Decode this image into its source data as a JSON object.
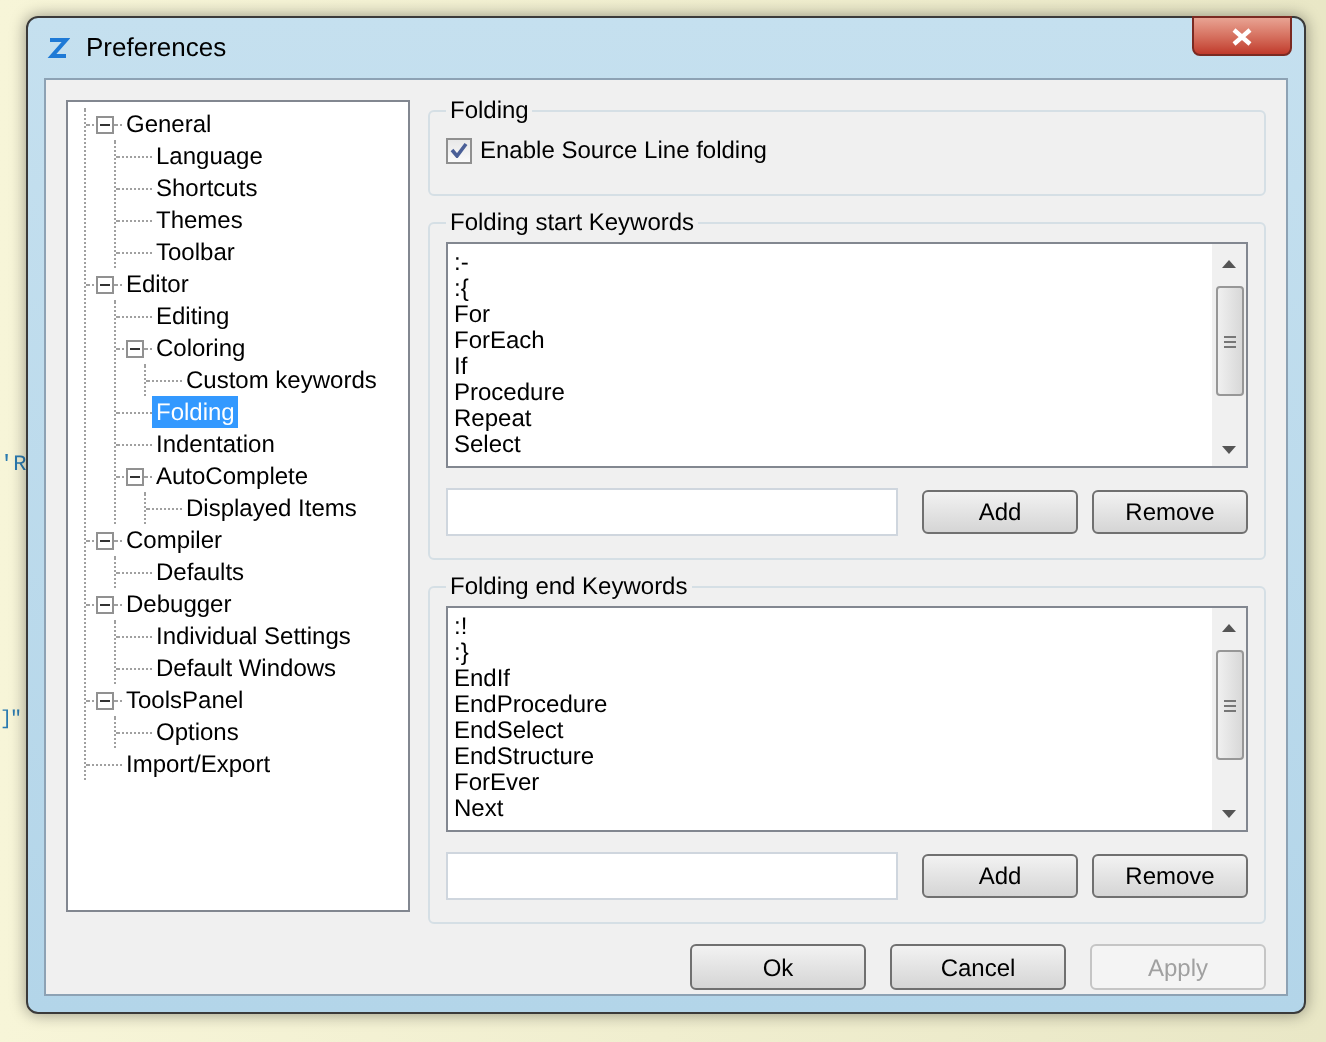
{
  "background_text": [
    "'R",
    "]\""
  ],
  "window": {
    "title": "Preferences"
  },
  "tree": [
    {
      "label": "General",
      "selected": false,
      "expanded": true,
      "children": [
        {
          "label": "Language",
          "selected": false
        },
        {
          "label": "Shortcuts",
          "selected": false
        },
        {
          "label": "Themes",
          "selected": false
        },
        {
          "label": "Toolbar",
          "selected": false
        }
      ]
    },
    {
      "label": "Editor",
      "selected": false,
      "expanded": true,
      "children": [
        {
          "label": "Editing",
          "selected": false
        },
        {
          "label": "Coloring",
          "selected": false,
          "expanded": true,
          "children": [
            {
              "label": "Custom keywords",
              "selected": false
            }
          ]
        },
        {
          "label": "Folding",
          "selected": true
        },
        {
          "label": "Indentation",
          "selected": false
        },
        {
          "label": "AutoComplete",
          "selected": false,
          "expanded": true,
          "children": [
            {
              "label": "Displayed Items",
              "selected": false
            }
          ]
        }
      ]
    },
    {
      "label": "Compiler",
      "selected": false,
      "expanded": true,
      "children": [
        {
          "label": "Defaults",
          "selected": false
        }
      ]
    },
    {
      "label": "Debugger",
      "selected": false,
      "expanded": true,
      "children": [
        {
          "label": "Individual Settings",
          "selected": false
        },
        {
          "label": "Default Windows",
          "selected": false
        }
      ]
    },
    {
      "label": "ToolsPanel",
      "selected": false,
      "expanded": true,
      "children": [
        {
          "label": "Options",
          "selected": false
        }
      ]
    },
    {
      "label": "Import/Export",
      "selected": false
    }
  ],
  "folding": {
    "title": "Folding",
    "checkbox": {
      "label": "Enable Source Line folding",
      "checked": true
    }
  },
  "keyword_groups": [
    {
      "title": "Folding start Keywords",
      "items": [
        ":-",
        ":{",
        "For",
        "ForEach",
        "If",
        "Procedure",
        "Repeat",
        "Select"
      ],
      "buttons": [
        "Add",
        "Remove"
      ]
    },
    {
      "title": "Folding end Keywords",
      "items": [
        ":!",
        ":}",
        "EndIf",
        "EndProcedure",
        "EndSelect",
        "EndStructure",
        "ForEver",
        "Next"
      ],
      "buttons": [
        "Add",
        "Remove"
      ]
    }
  ],
  "dialog_buttons": [
    {
      "label": "Ok",
      "disabled": false
    },
    {
      "label": "Cancel",
      "disabled": false
    },
    {
      "label": "Apply",
      "disabled": true
    }
  ]
}
